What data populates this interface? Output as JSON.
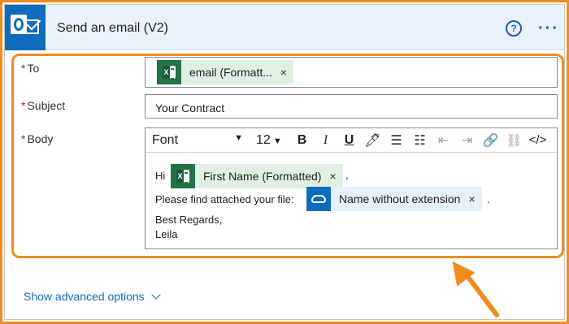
{
  "header": {
    "title": "Send an email (V2)",
    "help_icon": "?",
    "more_icon": "···"
  },
  "fields": {
    "to": {
      "label": "To",
      "token": "email (Formatt...",
      "token_source": "excel"
    },
    "subject": {
      "label": "Subject",
      "value": "Your Contract"
    },
    "body": {
      "label": "Body",
      "toolbar": {
        "font": "Font",
        "size": "12",
        "bold": "B",
        "italic": "I",
        "underline": "U"
      },
      "line1_prefix": "Hi",
      "token1": "First Name (Formatted)",
      "line1_suffix": ",",
      "line2_prefix": "Please find attached your file:",
      "token2": "Name without extension",
      "line2_suffix": ".",
      "closing": "Best Regards,",
      "signature": "Leila"
    }
  },
  "required_marker": "*",
  "remove_token_glyph": "×",
  "advanced_link": "Show advanced options",
  "colors": {
    "highlight": "#f08c1e",
    "accent": "#0f6cbd",
    "excel": "#217346",
    "required": "#a4262c"
  }
}
